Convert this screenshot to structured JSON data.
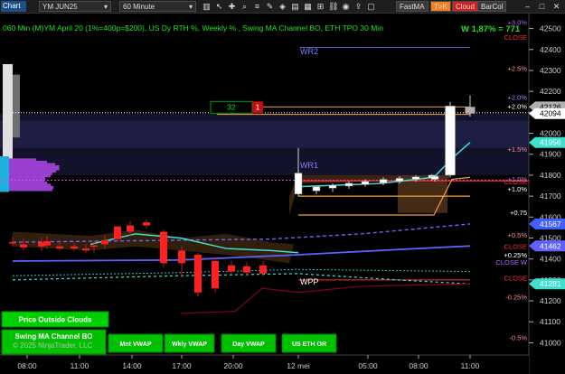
{
  "toolbar": {
    "chart_label": "Chart",
    "instrument": "YM JUN25",
    "period": "60 Minute",
    "buttons": [
      "FastMA",
      "T>K",
      "Cloud",
      "BarCol"
    ],
    "button_colors": [
      "#3a3a3a",
      "#f08020",
      "#d02020",
      "#3a3a3a"
    ]
  },
  "header": {
    "title": "060 Min (M)YM April 20 (1%=400p=$200), US Dy RTH %, Weekly % , Swing MA Channel BO, ETH TPO 30 Min",
    "weekly_summary": "W 1,87% = 771",
    "copyright": "© 2025 NinjaTrader, LLC"
  },
  "chart_data": {
    "type": "candlestick",
    "y_range": [
      40950,
      42550
    ],
    "x_tick_labels": [
      "08:00",
      "11:00",
      "14:00",
      "17:00",
      "20:00",
      "12 mei",
      "05:00",
      "08:00",
      "11:00"
    ],
    "y_tick_labels": [
      41000,
      41100,
      41200,
      41300,
      41400,
      41500,
      41600,
      41700,
      41800,
      41900,
      42000,
      42100,
      42200,
      42300,
      42400,
      42500
    ],
    "price_tags": [
      {
        "value": 42126,
        "color": "#b0b0b0"
      },
      {
        "value": 42094,
        "color": "#ffffff"
      },
      {
        "value": 41956,
        "color": "#40e0d0"
      },
      {
        "value": 41567,
        "color": "#4060ff"
      },
      {
        "value": 41462,
        "color": "#6060ff"
      },
      {
        "value": 41281,
        "color": "#40e0d0"
      }
    ],
    "percent_labels": [
      {
        "text": "+3,0%",
        "value": 42530,
        "color": "#b060ff"
      },
      {
        "text": "+2.5%",
        "value": 42310,
        "color": "#ff9090"
      },
      {
        "text": "+2.0%",
        "value": 42130,
        "color": "#ffffff"
      },
      {
        "text": "+2.0%",
        "value": 42172,
        "color": "#9090ff"
      },
      {
        "text": "+1.5%",
        "value": 41925,
        "color": "#ff9090"
      },
      {
        "text": "+1.0%",
        "value": 41783,
        "color": "#9090ff"
      },
      {
        "text": "+1.0%",
        "value": 41735,
        "color": "#ffffff"
      },
      {
        "text": "+0.75",
        "value": 41623,
        "color": "#ffffff"
      },
      {
        "text": "+0.5%",
        "value": 41515,
        "color": "#ff9090"
      },
      {
        "text": "+0.25%",
        "value": 41420,
        "color": "#ffffff"
      },
      {
        "text": "-0.25%",
        "value": 41220,
        "color": "#ff9090"
      },
      {
        "text": "-0.5%",
        "value": 41025,
        "color": "#ff9090"
      }
    ],
    "close_labels": [
      {
        "text": "CLOSE",
        "value": 42460,
        "color": "#ff3030"
      },
      {
        "text": "CLOSE",
        "value": 41770,
        "color": "#ff3030"
      },
      {
        "text": "CLOSE",
        "value": 41460,
        "color": "#ff3030"
      },
      {
        "text": "CLOSE W",
        "value": 41385,
        "color": "#b070ff"
      },
      {
        "text": "CLOSE",
        "value": 41310,
        "color": "#ff3030"
      }
    ],
    "annotations": [
      {
        "text": "WR2",
        "value": 42390,
        "color": "#8080ff"
      },
      {
        "text": "WR1",
        "value": 41848,
        "color": "#8080ff"
      },
      {
        "text": "WPP",
        "value": 41290,
        "color": "#ffffff"
      }
    ],
    "order_box": {
      "quantity": "32",
      "marker": "1",
      "value": 42126
    },
    "candles": [
      {
        "o": 41480,
        "h": 41505,
        "l": 41460,
        "c": 41475,
        "color": "#ff2020"
      },
      {
        "o": 41470,
        "h": 41500,
        "l": 41445,
        "c": 41455,
        "color": "#ff2020"
      },
      {
        "o": 41480,
        "h": 41505,
        "l": 41440,
        "c": 41460,
        "color": "#ff2020"
      },
      {
        "o": 41485,
        "h": 41510,
        "l": 41450,
        "c": 41465,
        "color": "#ff2020"
      },
      {
        "o": 41460,
        "h": 41490,
        "l": 41440,
        "c": 41450,
        "color": "#ff2020"
      },
      {
        "o": 41460,
        "h": 41480,
        "l": 41440,
        "c": 41450,
        "color": "#ff2020"
      },
      {
        "o": 41450,
        "h": 41470,
        "l": 41430,
        "c": 41440,
        "color": "#ff2020"
      },
      {
        "o": 41460,
        "h": 41490,
        "l": 41430,
        "c": 41465,
        "color": "#ff2020"
      },
      {
        "o": 41470,
        "h": 41510,
        "l": 41450,
        "c": 41490,
        "color": "#ff2020"
      },
      {
        "o": 41495,
        "h": 41560,
        "l": 41480,
        "c": 41555,
        "color": "#ff2020"
      },
      {
        "o": 41560,
        "h": 41580,
        "l": 41510,
        "c": 41530,
        "color": "#ff2020"
      },
      {
        "o": 41575,
        "h": 41590,
        "l": 41545,
        "c": 41560,
        "color": "#ff2020"
      },
      {
        "o": 41530,
        "h": 41540,
        "l": 41360,
        "c": 41380,
        "color": "#ff2020"
      },
      {
        "o": 41440,
        "h": 41460,
        "l": 41310,
        "c": 41380,
        "color": "#ff2020"
      },
      {
        "o": 41420,
        "h": 41430,
        "l": 41220,
        "c": 41240,
        "color": "#ff2020"
      },
      {
        "o": 41390,
        "h": 41410,
        "l": 41240,
        "c": 41260,
        "color": "#ff2020"
      },
      {
        "o": 41370,
        "h": 41390,
        "l": 41330,
        "c": 41340,
        "color": "#ff2020"
      },
      {
        "o": 41365,
        "h": 41385,
        "l": 41320,
        "c": 41335,
        "color": "#ff2020"
      },
      {
        "o": 41370,
        "h": 41390,
        "l": 41320,
        "c": 41330,
        "color": "#ff2020"
      },
      {
        "o": 41810,
        "h": 41930,
        "l": 41700,
        "c": 41710,
        "color": "#ffffff"
      },
      {
        "o": 41725,
        "h": 41750,
        "l": 41710,
        "c": 41745,
        "color": "#ffffff"
      },
      {
        "o": 41738,
        "h": 41760,
        "l": 41720,
        "c": 41752,
        "color": "#ffffff"
      },
      {
        "o": 41748,
        "h": 41770,
        "l": 41735,
        "c": 41762,
        "color": "#ffffff"
      },
      {
        "o": 41755,
        "h": 41780,
        "l": 41745,
        "c": 41770,
        "color": "#ffffff"
      },
      {
        "o": 41762,
        "h": 41790,
        "l": 41752,
        "c": 41780,
        "color": "#ffffff"
      },
      {
        "o": 41770,
        "h": 41795,
        "l": 41760,
        "c": 41785,
        "color": "#ffffff"
      },
      {
        "o": 41780,
        "h": 41800,
        "l": 41770,
        "c": 41792,
        "color": "#ffffff"
      },
      {
        "o": 41785,
        "h": 41805,
        "l": 41775,
        "c": 41800,
        "color": "#ffffff"
      },
      {
        "o": 41780,
        "h": 41800,
        "l": 41770,
        "c": 41795,
        "color": "#ffffff"
      },
      {
        "o": 41800,
        "h": 42150,
        "l": 41790,
        "c": 42130,
        "color": "#ffffff"
      },
      {
        "o": 42094,
        "h": 42180,
        "l": 42080,
        "c": 42126,
        "color": "#b0b0b0"
      }
    ]
  },
  "buttons": [
    {
      "label": "Price Outside Clouds",
      "color": "#00d000"
    },
    {
      "label": "Swing MA Channel BO",
      "color": "#00c000"
    },
    {
      "label": "Mnt VWAP",
      "color": "#00c000"
    },
    {
      "label": "Wkly VWAP",
      "color": "#00c000"
    },
    {
      "label": "Day VWAP",
      "color": "#00c000"
    },
    {
      "label": "US ETH OR",
      "color": "#00c000"
    }
  ]
}
